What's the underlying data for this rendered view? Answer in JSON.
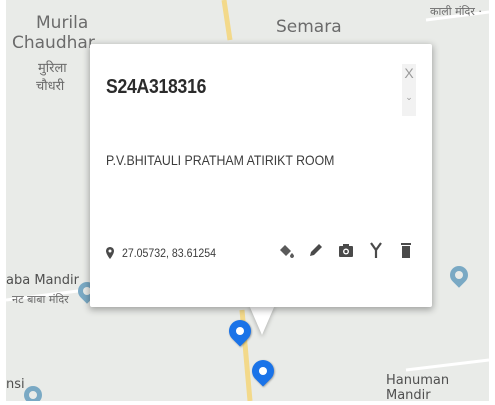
{
  "map": {
    "places": {
      "murila": "Murila",
      "chaudhari": "Chaudhar",
      "murila_hindi_1": "मुरिला",
      "murila_hindi_2": "चौधरी",
      "semara": "Semara",
      "kali_mandir": "काली मंदिर ·",
      "baba_mandir": "aba Mandir",
      "baba_mandir_hindi": "नट बाबा मंदिर",
      "hanuman_mandir": "Hanuman Mandir",
      "bottom_left": "nsi"
    },
    "colors": {
      "background": "#e9ebe8",
      "road": "#ffffff",
      "marker": "#1a73e8",
      "poi": "#7aa9c4"
    }
  },
  "popup": {
    "title": "S24A318316",
    "description": "P.V.BHITAULI PRATHAM ATIRIKT ROOM",
    "close_label": "X",
    "coordinates": "27.05732, 83.61254",
    "icons": [
      "paint-bucket-icon",
      "pencil-icon",
      "camera-icon",
      "fork-icon",
      "trash-icon"
    ]
  }
}
